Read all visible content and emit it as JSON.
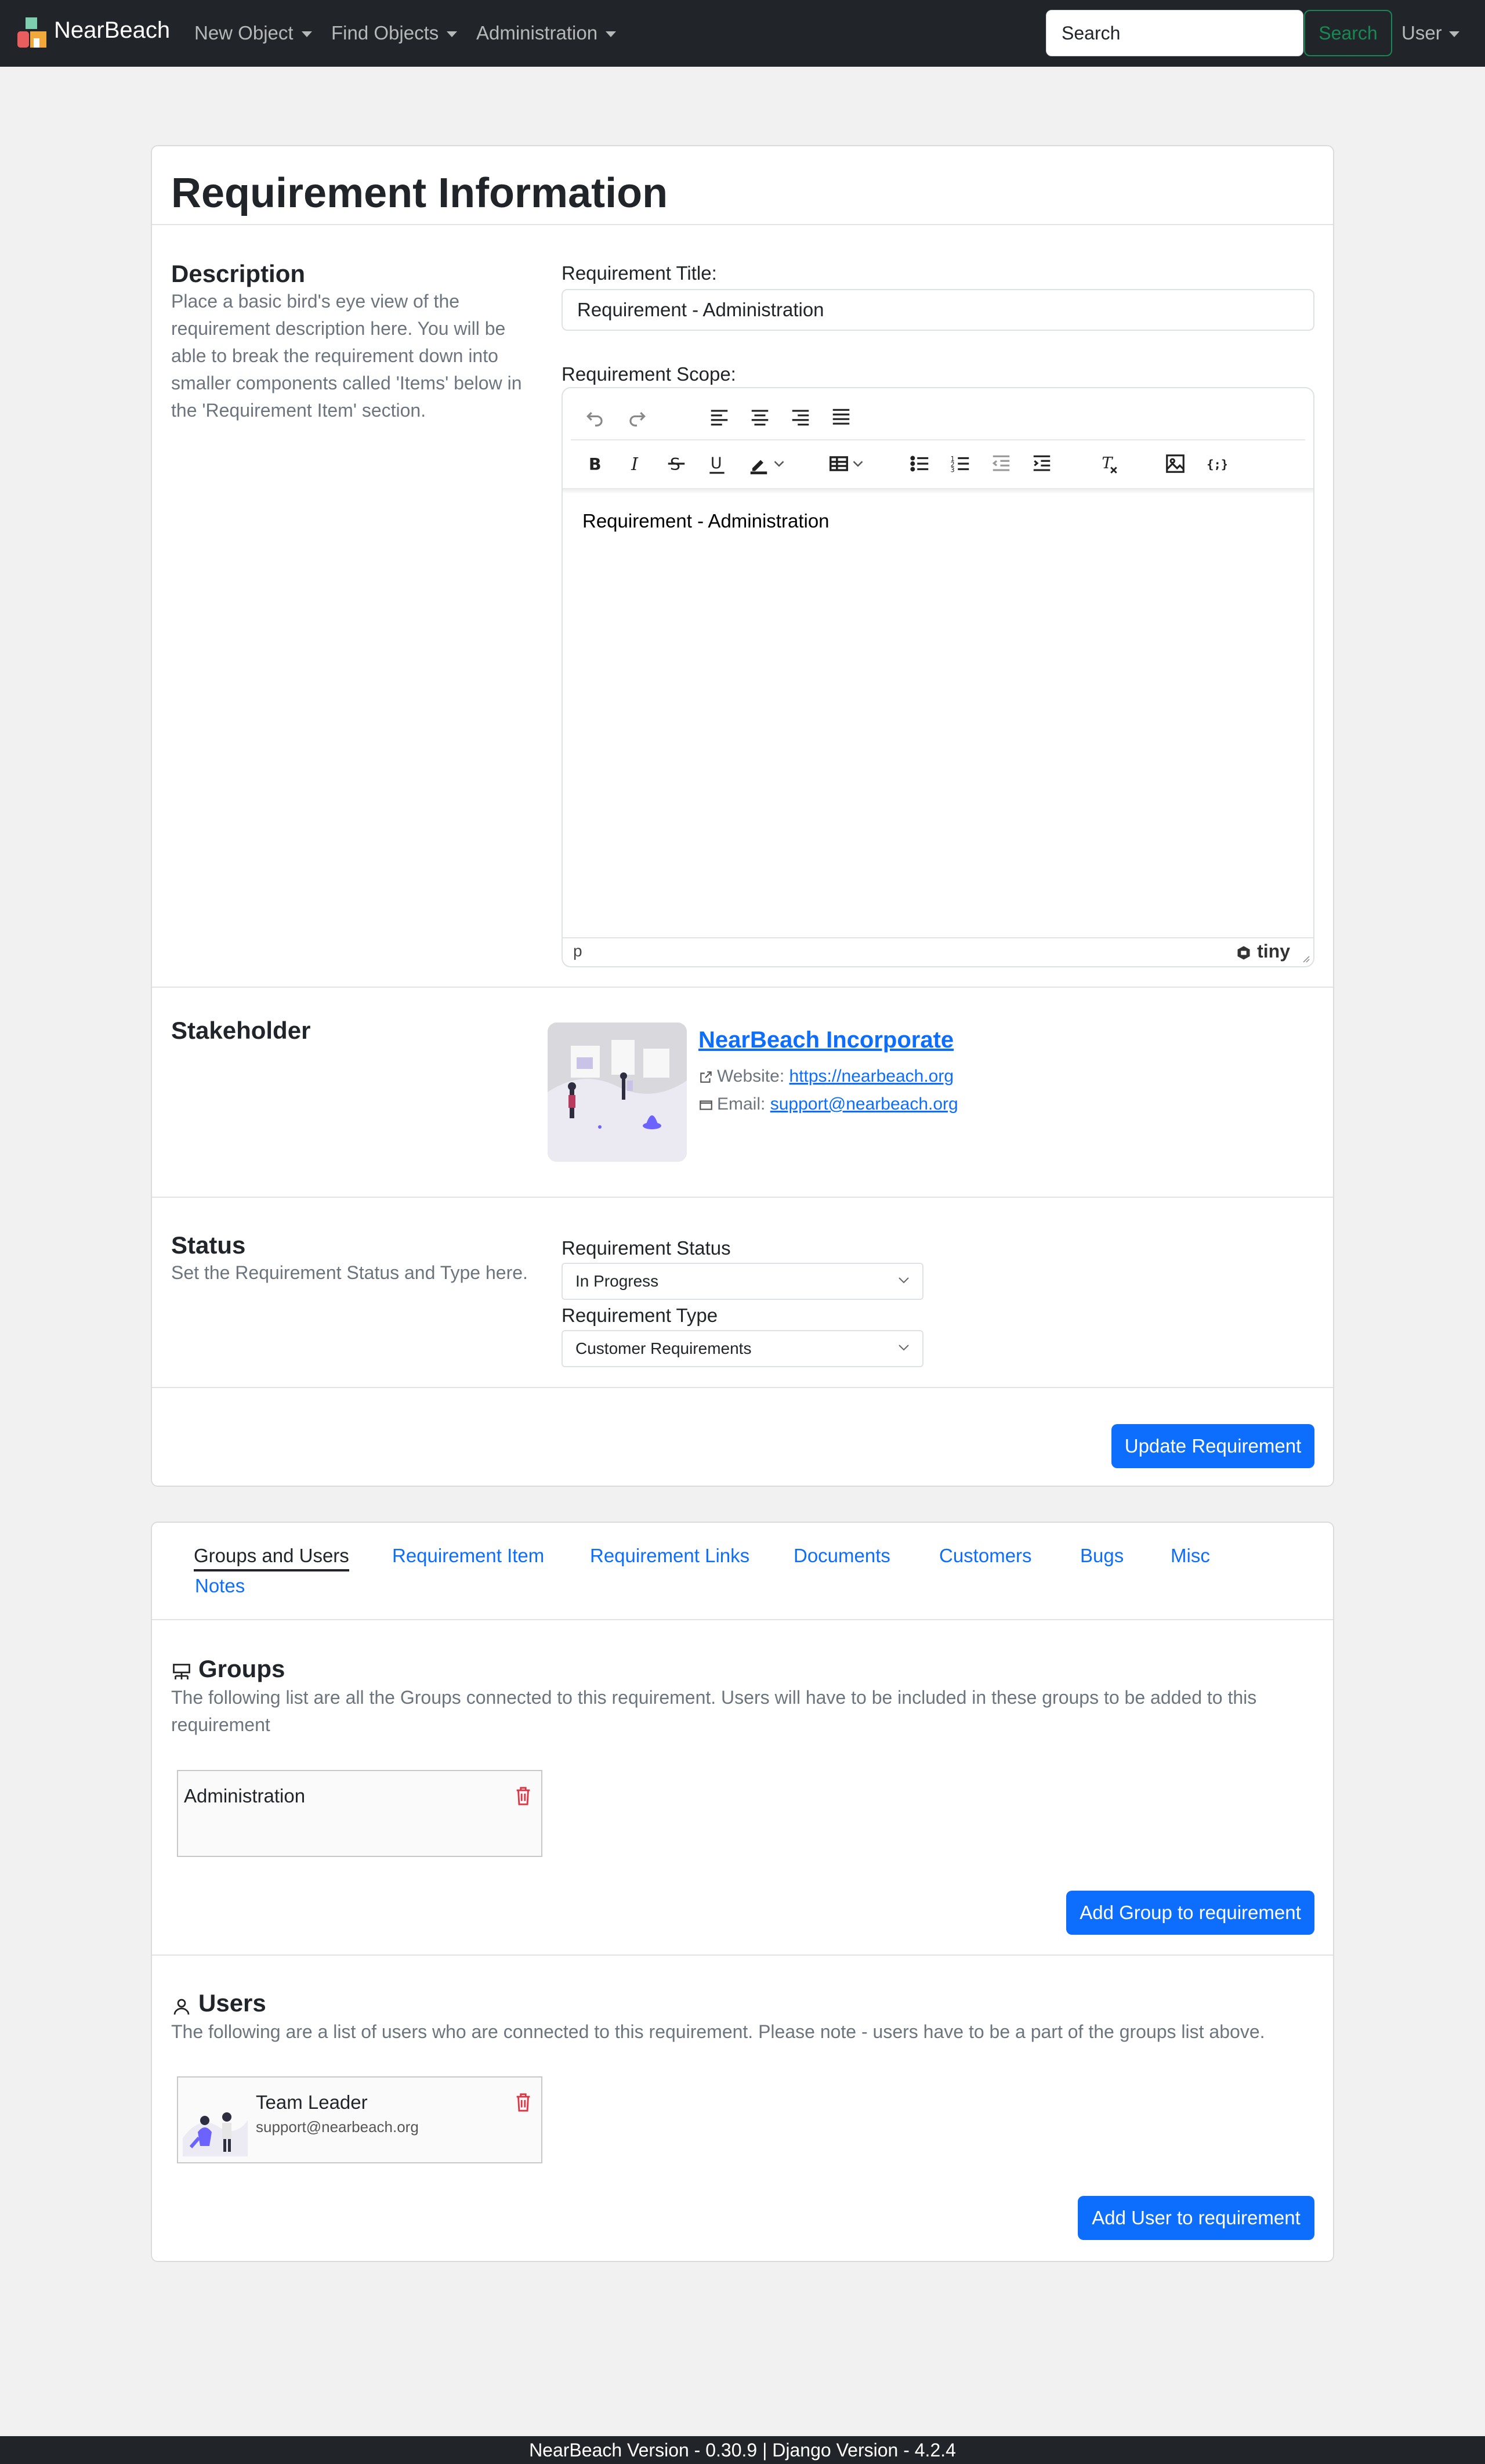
{
  "navbar": {
    "brand": "NearBeach",
    "menus": [
      "New Object",
      "Find Objects",
      "Administration"
    ],
    "search_placeholder": "Search",
    "search_button": "Search",
    "user_menu": "User"
  },
  "requirement": {
    "title": "Requirement Information",
    "description_heading": "Description",
    "description_text": "Place a basic bird's eye view of the requirement description here. You will be able to break the requirement down into smaller components called 'Items' below in the 'Requirement Item' section.",
    "title_label": "Requirement Title:",
    "title_value": "Requirement - Administration",
    "scope_label": "Requirement Scope:",
    "editor": {
      "content": "Requirement - Administration",
      "status_path": "p",
      "brand": "tiny"
    },
    "stakeholder_heading": "Stakeholder",
    "stakeholder": {
      "name": "NearBeach Incorporate",
      "website_label": "Website:",
      "website": "https://nearbeach.org",
      "email_label": "Email:",
      "email": "support@nearbeach.org"
    },
    "status_heading": "Status",
    "status_desc": "Set the Requirement Status and Type here.",
    "status_label": "Requirement Status",
    "status_value": "In Progress",
    "type_label": "Requirement Type",
    "type_value": "Customer Requirements",
    "update_button": "Update Requirement"
  },
  "tabs": [
    "Groups and Users",
    "Requirement Item",
    "Requirement Links",
    "Documents",
    "Customers",
    "Bugs",
    "Misc",
    "Notes"
  ],
  "groups": {
    "heading": "Groups",
    "desc": "The following list are all the Groups connected to this requirement. Users will have to be included in these groups to be added to this requirement",
    "items": [
      {
        "name": "Administration"
      }
    ],
    "add_button": "Add Group to requirement"
  },
  "users": {
    "heading": "Users",
    "desc": "The following are a list of users who are connected to this requirement. Please note - users have to be a part of the groups list above.",
    "items": [
      {
        "name": "Team Leader",
        "email": "support@nearbeach.org"
      }
    ],
    "add_button": "Add User to requirement"
  },
  "footer": "NearBeach Version - 0.30.9 | Django Version - 4.2.4",
  "colors": {
    "primary": "#0d6efd",
    "navbar": "#212529",
    "success": "#198754",
    "danger": "#dc3545"
  }
}
